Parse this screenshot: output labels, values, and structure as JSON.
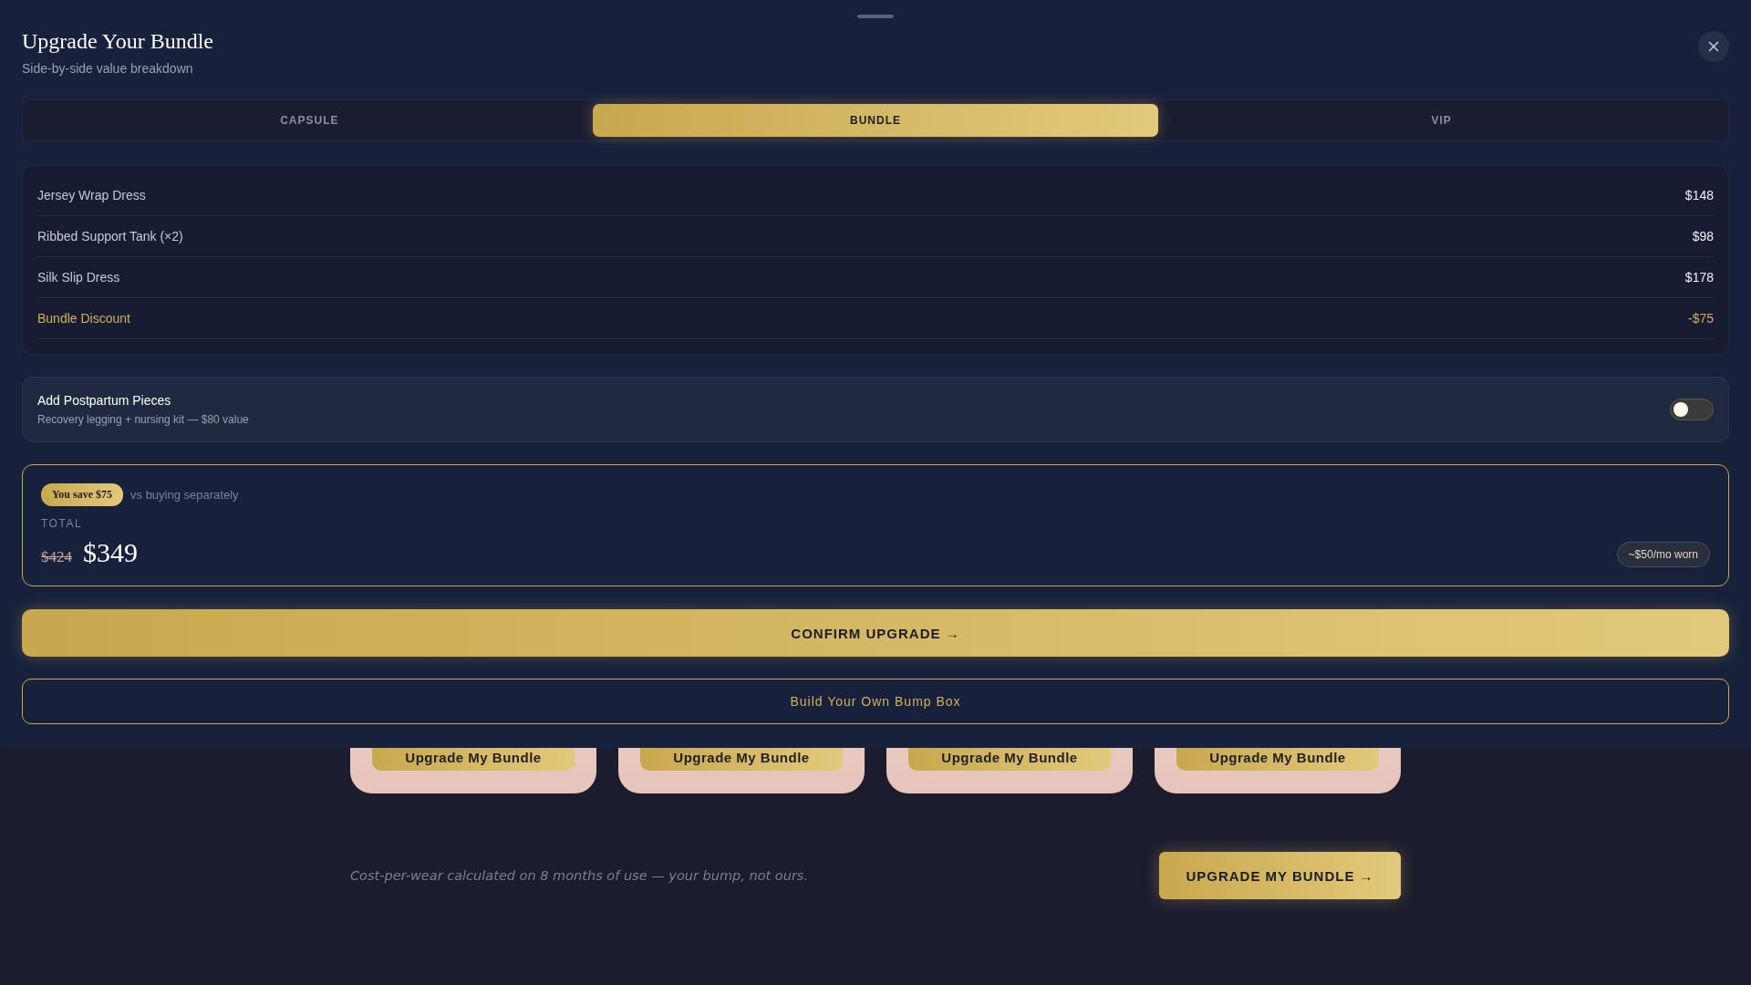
{
  "sheet": {
    "title": "Upgrade Your Bundle",
    "subtitle": "Side-by-side value breakdown",
    "tabs": [
      {
        "label": "CAPSULE",
        "selected": false
      },
      {
        "label": "BUNDLE",
        "selected": true
      },
      {
        "label": "VIP",
        "selected": false
      }
    ],
    "items": [
      {
        "kind": "item",
        "name": "Jersey Wrap Dress",
        "price": "$148"
      },
      {
        "kind": "item",
        "name": "Ribbed Support Tank (×2)",
        "price": "$98"
      },
      {
        "kind": "item",
        "name": "Silk Slip Dress",
        "price": "$178"
      },
      {
        "kind": "discount",
        "name": "Bundle Discount",
        "price": "-$75"
      }
    ],
    "addon": {
      "title": "Add Postpartum Pieces",
      "description": "Recovery legging + nursing kit — $80 value",
      "on": false
    },
    "summary": {
      "badge": "You save $75",
      "note": "vs buying separately",
      "label": "TOTAL",
      "old_price": "$424",
      "price": "$349",
      "per_month": "~$50/mo worn"
    },
    "confirm_button": "CONFIRM UPGRADE →",
    "secondary_button": "Build Your Own Bump Box"
  },
  "background": {
    "cards": [
      {
        "button": "Upgrade My Bundle"
      },
      {
        "button": "Upgrade My Bundle"
      },
      {
        "button": "Upgrade My Bundle"
      },
      {
        "button": "Upgrade My Bundle"
      }
    ],
    "footnote": "Cost-per-wear calculated on 8 months of use — your bump, not ours.",
    "cta": "UPGRADE MY BUNDLE →"
  }
}
